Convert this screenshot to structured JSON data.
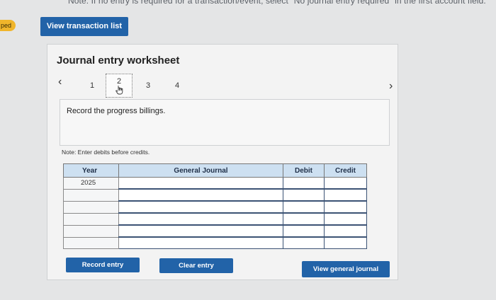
{
  "banner": {
    "text": "Note: If no entry is required for a transaction/event, select \"No journal entry required\" in the first account field."
  },
  "left_badge": {
    "label": "ped"
  },
  "header": {
    "view_transaction_list": "View transaction list"
  },
  "worksheet": {
    "title": "Journal entry worksheet",
    "steps": [
      "1",
      "2",
      "3",
      "4"
    ],
    "current_step": 2,
    "instruction": "Record the progress billings.",
    "note": "Note: Enter debits before credits."
  },
  "table": {
    "columns": [
      "Year",
      "General Journal",
      "Debit",
      "Credit"
    ],
    "rows": [
      {
        "year": "2025",
        "journal": "",
        "debit": "",
        "credit": ""
      },
      {
        "year": "",
        "journal": "",
        "debit": "",
        "credit": ""
      },
      {
        "year": "",
        "journal": "",
        "debit": "",
        "credit": ""
      },
      {
        "year": "",
        "journal": "",
        "debit": "",
        "credit": ""
      },
      {
        "year": "",
        "journal": "",
        "debit": "",
        "credit": ""
      },
      {
        "year": "",
        "journal": "",
        "debit": "",
        "credit": ""
      }
    ]
  },
  "buttons": {
    "record": "Record entry",
    "clear": "Clear entry",
    "view_journal": "View general journal"
  },
  "icons": {
    "prev": "chevron-left-icon",
    "next": "chevron-right-icon",
    "cursor": "hand-pointer-icon"
  },
  "colors": {
    "primary": "#2263a8",
    "table_header": "#cde0f1",
    "badge": "#f0b52b"
  }
}
